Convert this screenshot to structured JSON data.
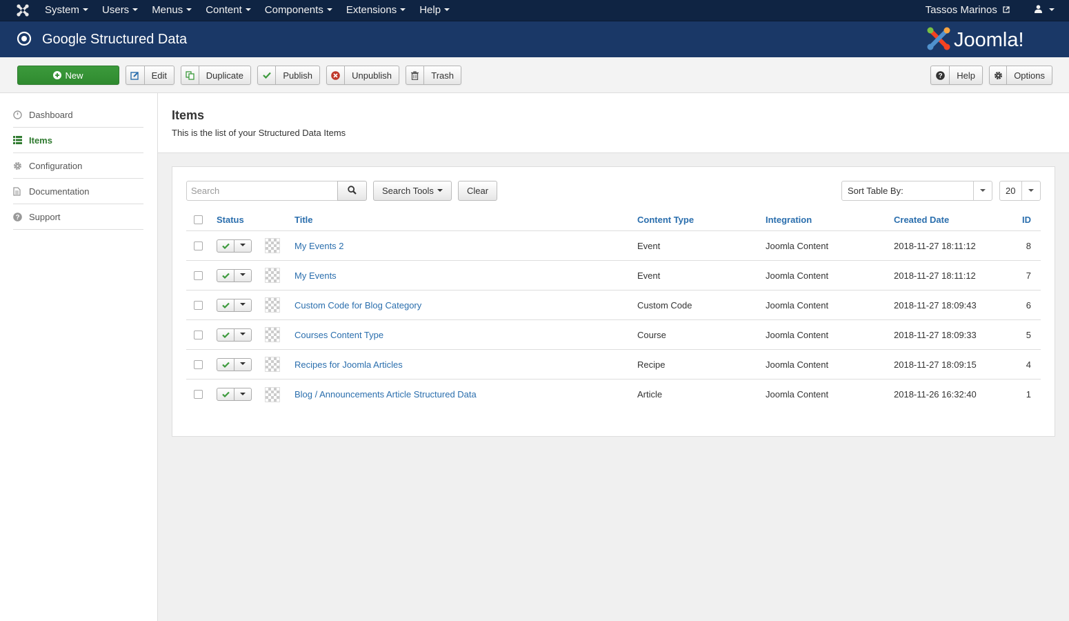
{
  "navbar": {
    "menus": [
      {
        "label": "System"
      },
      {
        "label": "Users"
      },
      {
        "label": "Menus"
      },
      {
        "label": "Content"
      },
      {
        "label": "Components"
      },
      {
        "label": "Extensions"
      },
      {
        "label": "Help"
      }
    ],
    "user_name": "Tassos Marinos",
    "icons": {
      "brand": "joomla-icon",
      "external": "external-link-icon",
      "user": "user-icon"
    }
  },
  "header": {
    "title": "Google Structured Data",
    "icon": "target-icon",
    "logo_text": "Joomla!"
  },
  "toolbar": {
    "new_label": "New",
    "edit_label": "Edit",
    "duplicate_label": "Duplicate",
    "publish_label": "Publish",
    "unpublish_label": "Unpublish",
    "trash_label": "Trash",
    "help_label": "Help",
    "options_label": "Options"
  },
  "sidebar": {
    "items": [
      {
        "label": "Dashboard",
        "icon": "dashboard-icon",
        "active": false
      },
      {
        "label": "Items",
        "icon": "list-icon",
        "active": true
      },
      {
        "label": "Configuration",
        "icon": "gear-icon",
        "active": false
      },
      {
        "label": "Documentation",
        "icon": "document-icon",
        "active": false
      },
      {
        "label": "Support",
        "icon": "question-icon",
        "active": false
      }
    ]
  },
  "page": {
    "title": "Items",
    "description": "This is the list of your Structured Data Items"
  },
  "filters": {
    "search_placeholder": "Search",
    "search_tools_label": "Search Tools",
    "clear_label": "Clear",
    "sort_label": "Sort Table By:",
    "limit_value": "20"
  },
  "table": {
    "columns": {
      "status": "Status",
      "title": "Title",
      "content_type": "Content Type",
      "integration": "Integration",
      "created_date": "Created Date",
      "id": "ID"
    },
    "rows": [
      {
        "title": "My Events 2",
        "content_type": "Event",
        "integration": "Joomla Content",
        "created_date": "2018-11-27 18:11:12",
        "id": "8",
        "published": true
      },
      {
        "title": "My Events",
        "content_type": "Event",
        "integration": "Joomla Content",
        "created_date": "2018-11-27 18:11:12",
        "id": "7",
        "published": true
      },
      {
        "title": "Custom Code for Blog Category",
        "content_type": "Custom Code",
        "integration": "Joomla Content",
        "created_date": "2018-11-27 18:09:43",
        "id": "6",
        "published": true
      },
      {
        "title": "Courses Content Type",
        "content_type": "Course",
        "integration": "Joomla Content",
        "created_date": "2018-11-27 18:09:33",
        "id": "5",
        "published": true
      },
      {
        "title": "Recipes for Joomla Articles",
        "content_type": "Recipe",
        "integration": "Joomla Content",
        "created_date": "2018-11-27 18:09:15",
        "id": "4",
        "published": true
      },
      {
        "title": "Blog / Announcements Article Structured Data",
        "content_type": "Article",
        "integration": "Joomla Content",
        "created_date": "2018-11-26 16:32:40",
        "id": "1",
        "published": true
      }
    ]
  },
  "colors": {
    "navbar_bg": "#0f2443",
    "header_bg": "#1a3867",
    "new_button": "#2f8a2f",
    "link": "#2a6ead",
    "active_sidebar": "#2f7a2f",
    "unpublish_icon": "#c0392b",
    "publish_icon": "#3c9a3c"
  }
}
